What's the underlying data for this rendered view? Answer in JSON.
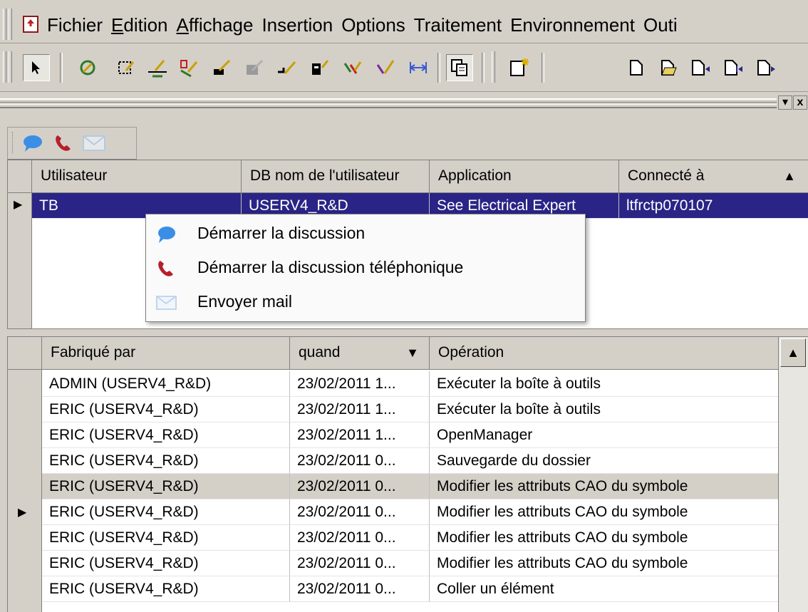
{
  "menubar": {
    "items": [
      {
        "label": "Fichier",
        "accel": ""
      },
      {
        "label": "Edition",
        "accel": "E"
      },
      {
        "label": "Affichage",
        "accel": "A"
      },
      {
        "label": "Insertion",
        "accel": ""
      },
      {
        "label": "Options",
        "accel": ""
      },
      {
        "label": "Traitement",
        "accel": ""
      },
      {
        "label": "Environnement",
        "accel": ""
      },
      {
        "label": "Outi",
        "accel": ""
      }
    ]
  },
  "toolbar": {
    "icons": [
      "arrow-select-icon",
      "drawing-tool-1-icon",
      "drawing-tool-2-icon",
      "drawing-tool-3-icon",
      "drawing-tool-4-icon",
      "drawing-tool-5-icon",
      "drawing-tool-6-icon",
      "drawing-tool-7-icon",
      "drawing-tool-8-icon",
      "drawing-tool-9-icon",
      "drawing-tool-10-icon",
      "measure-icon",
      "copy-icon",
      "new-sheet-icon",
      "page-icon",
      "page-open-icon",
      "page-prev-icon",
      "page-first-icon",
      "page-next-icon"
    ]
  },
  "panel": {
    "close_glyph": "x",
    "dropdown_glyph": "▾"
  },
  "mini_toolbar": {
    "icons": [
      "chat-bubble-icon",
      "phone-icon",
      "envelope-icon"
    ],
    "colors": {
      "chat": "#3a8ee6",
      "phone": "#b5202a",
      "mail": "#a8c8e8"
    }
  },
  "users_grid": {
    "columns": [
      "Utilisateur",
      "DB nom de l'utilisateur",
      "Application",
      "Connecté à"
    ],
    "sort_glyph": "▲",
    "rows": [
      {
        "user": "TB",
        "db_user": "USERV4_R&D",
        "application": "See Electrical Expert",
        "connected": "ltfrctp070107"
      }
    ]
  },
  "context_menu": {
    "items": [
      {
        "label": "Démarrer la discussion",
        "icon": "chat-bubble-icon"
      },
      {
        "label": "Démarrer la discussion téléphonique",
        "icon": "phone-icon"
      },
      {
        "label": "Envoyer mail",
        "icon": "envelope-icon"
      }
    ]
  },
  "history_grid": {
    "columns": [
      "Fabriqué par",
      "quand",
      "Opération"
    ],
    "sort_glyph": "▼",
    "rows": [
      {
        "by": "ADMIN (USERV4_R&D)",
        "when": "23/02/2011 1...",
        "op": "Exécuter la boîte à outils"
      },
      {
        "by": "ERIC (USERV4_R&D)",
        "when": "23/02/2011 1...",
        "op": "Exécuter la boîte à outils"
      },
      {
        "by": "ERIC (USERV4_R&D)",
        "when": "23/02/2011 1...",
        "op": "OpenManager"
      },
      {
        "by": "ERIC (USERV4_R&D)",
        "when": "23/02/2011 0...",
        "op": "Sauvegarde du dossier"
      },
      {
        "by": "ERIC (USERV4_R&D)",
        "when": "23/02/2011 0...",
        "op": "Modifier les attributs CAO du symbole"
      },
      {
        "by": "ERIC (USERV4_R&D)",
        "when": "23/02/2011 0...",
        "op": "Modifier les attributs CAO du symbole"
      },
      {
        "by": "ERIC (USERV4_R&D)",
        "when": "23/02/2011 0...",
        "op": "Modifier les attributs CAO du symbole"
      },
      {
        "by": "ERIC (USERV4_R&D)",
        "when": "23/02/2011 0...",
        "op": "Modifier les attributs CAO du symbole"
      },
      {
        "by": "ERIC (USERV4_R&D)",
        "when": "23/02/2011 0...",
        "op": "Coller un élément"
      }
    ]
  }
}
